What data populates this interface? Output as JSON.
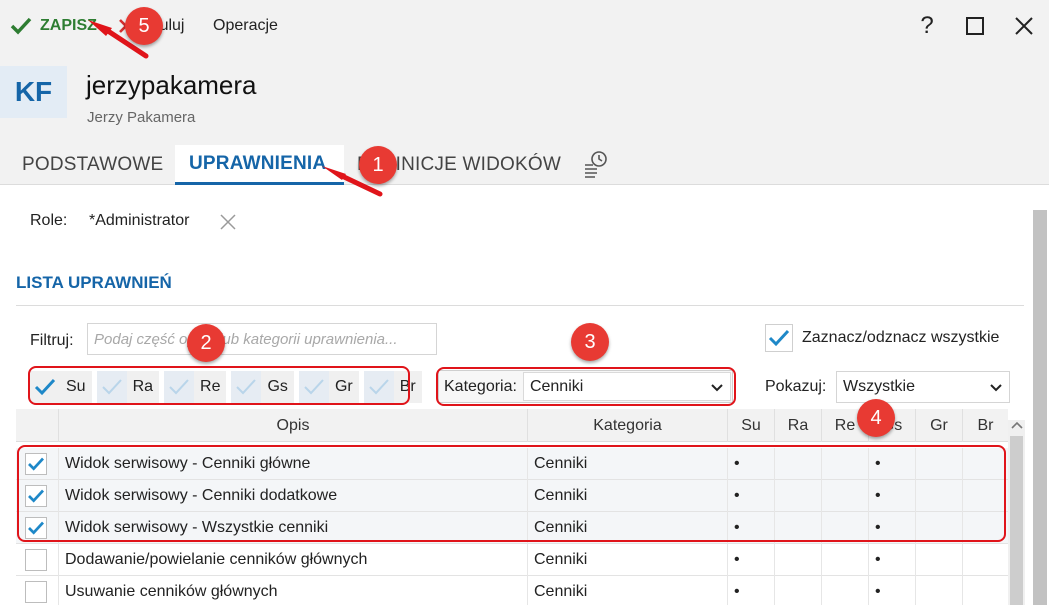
{
  "toolbar": {
    "save_label": "ZAPISZ",
    "cancel_label": "Anuluj",
    "operations_label": "Operacje",
    "help_label": "?"
  },
  "user": {
    "initials": "KF",
    "login": "jerzypakamera",
    "full_name": "Jerzy Pakamera"
  },
  "tabs": [
    {
      "label": "PODSTAWOWE",
      "active": false
    },
    {
      "label": "UPRAWNIENIA",
      "active": true
    },
    {
      "label": "DEFINICJE WIDOKÓW",
      "active": false
    }
  ],
  "role": {
    "label": "Role:",
    "value": "*Administrator"
  },
  "section_title": "LISTA UPRAWNIEŃ",
  "filter": {
    "label": "Filtruj:",
    "placeholder": "Podaj część opisu lub kategorii uprawnienia..."
  },
  "select_all_label": "Zaznacz/odznacz wszystkie",
  "toggles": [
    {
      "label": "Su",
      "on": true
    },
    {
      "label": "Ra",
      "on": false
    },
    {
      "label": "Re",
      "on": false
    },
    {
      "label": "Gs",
      "on": false
    },
    {
      "label": "Gr",
      "on": false
    },
    {
      "label": "Br",
      "on": false
    }
  ],
  "category": {
    "label": "Kategoria:",
    "value": "Cenniki"
  },
  "show": {
    "label": "Pokazuj:",
    "value": "Wszystkie"
  },
  "table": {
    "columns": [
      "Opis",
      "Kategoria",
      "Su",
      "Ra",
      "Re",
      "Gs",
      "Gr",
      "Br"
    ],
    "rows": [
      {
        "checked": true,
        "desc": "Widok serwisowy - Cenniki główne",
        "category": "Cenniki",
        "su": "•",
        "ra": "",
        "re": "",
        "gs": "•",
        "gr": "",
        "br": ""
      },
      {
        "checked": true,
        "desc": "Widok serwisowy - Cenniki dodatkowe",
        "category": "Cenniki",
        "su": "•",
        "ra": "",
        "re": "",
        "gs": "•",
        "gr": "",
        "br": ""
      },
      {
        "checked": true,
        "desc": "Widok serwisowy - Wszystkie cenniki",
        "category": "Cenniki",
        "su": "•",
        "ra": "",
        "re": "",
        "gs": "•",
        "gr": "",
        "br": ""
      },
      {
        "checked": false,
        "desc": "Dodawanie/powielanie cenników głównych",
        "category": "Cenniki",
        "su": "•",
        "ra": "",
        "re": "",
        "gs": "•",
        "gr": "",
        "br": ""
      },
      {
        "checked": false,
        "desc": "Usuwanie cenników głównych",
        "category": "Cenniki",
        "su": "•",
        "ra": "",
        "re": "",
        "gs": "•",
        "gr": "",
        "br": ""
      }
    ]
  },
  "annotations": [
    "1",
    "2",
    "3",
    "4",
    "5"
  ],
  "colors": {
    "accent": "#1565a8",
    "save_green": "#2e7d32",
    "annotation_red": "#e0141a",
    "check_blue": "#1e88c8"
  }
}
